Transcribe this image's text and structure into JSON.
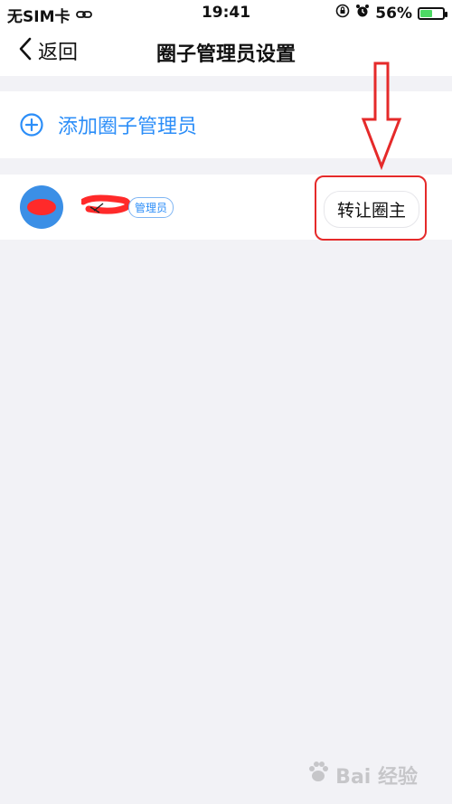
{
  "status_bar": {
    "carrier": "无SIM卡",
    "time": "19:41",
    "battery": "56%",
    "battery_level": 0.56
  },
  "nav": {
    "back_label": "返回",
    "title": "圈子管理员设置"
  },
  "add_admin": {
    "label": "添加圈子管理员"
  },
  "admin_list": [
    {
      "badge": "管理员",
      "action": "转让圈主"
    }
  ],
  "colors": {
    "accent": "#2c8ef8",
    "annotation_red": "#e52a2a",
    "background": "#f2f2f6"
  },
  "watermark": {
    "text": "Bai 经验"
  }
}
